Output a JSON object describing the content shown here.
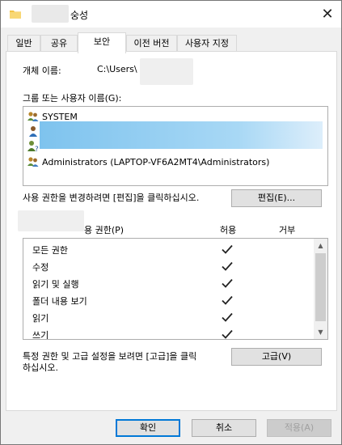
{
  "window": {
    "title_visible": "숭성",
    "close_glyph": "✕"
  },
  "tabs": [
    {
      "label": "일반",
      "active": false
    },
    {
      "label": "공유",
      "active": false
    },
    {
      "label": "보안",
      "active": true
    },
    {
      "label": "이전 버전",
      "active": false
    },
    {
      "label": "사용자 지정",
      "active": false
    }
  ],
  "security": {
    "object_name_label": "개체 이름:",
    "object_name_value": "C:\\Users\\",
    "groups_label": "그룹 또는 사용자 이름(G):",
    "groups": [
      {
        "icon": "users-group-icon",
        "name": "SYSTEM"
      },
      {
        "icon": "user-icon",
        "name": ""
      },
      {
        "icon": "user-unknown-icon",
        "name": ""
      },
      {
        "icon": "users-group-icon",
        "name": "Administrators (LAPTOP-VF6A2MT4\\Administrators)"
      }
    ],
    "change_hint": "사용 권한을 변경하려면 [편집]을 클릭하십시오.",
    "edit_button": "편집(E)...",
    "permissions_header": "용 권한(P)",
    "allow_header": "허용",
    "deny_header": "거부",
    "permissions": [
      {
        "name": "모든 권한",
        "allow": true,
        "deny": false
      },
      {
        "name": "수정",
        "allow": true,
        "deny": false
      },
      {
        "name": "읽기 및 실행",
        "allow": true,
        "deny": false
      },
      {
        "name": "폴더 내용 보기",
        "allow": true,
        "deny": false
      },
      {
        "name": "읽기",
        "allow": true,
        "deny": false
      },
      {
        "name": "쓰기",
        "allow": true,
        "deny": false
      }
    ],
    "advanced_hint_line1": "특정 권한 및 고급 설정을 보려면 [고급]을 클릭",
    "advanced_hint_line2": "하십시오.",
    "advanced_button": "고급(V)"
  },
  "footer": {
    "ok": "확인",
    "cancel": "취소",
    "apply": "적용(A)"
  },
  "colors": {
    "selection": "#7ec3ee",
    "accent_border": "#0078d7",
    "folder": "#f3c44a"
  }
}
